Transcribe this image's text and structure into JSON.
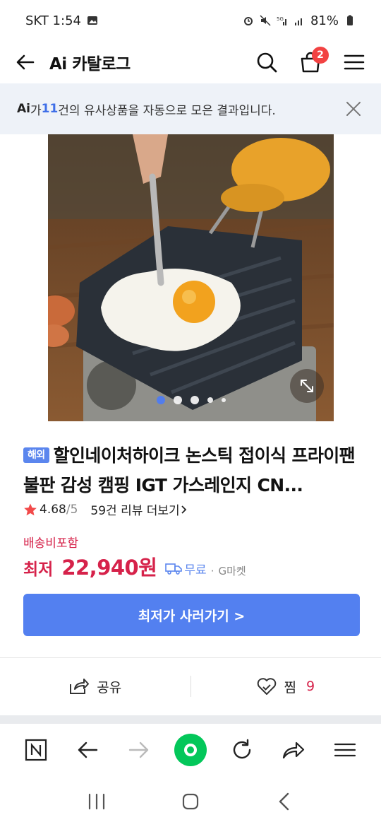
{
  "status_bar": {
    "carrier_time": "SKT 1:54",
    "battery": "81%"
  },
  "header": {
    "title": "Ai 카탈로그",
    "cart_count": "2"
  },
  "ai_banner": {
    "logo": "Ai",
    "prefix": "가 ",
    "count": "11",
    "suffix": "건의 유사상품을 자동으로 모은 결과입니다."
  },
  "product": {
    "badge": "해외",
    "title": "할인네이처하이크 논스틱 접이식 프라이팬 불판 감성 캠핑 IGT 가스레인지 CN...",
    "rating": "4.68",
    "rating_max": "/5",
    "reviews": "59건 리뷰 더보기",
    "shipping_note": "배송비포함",
    "price_label": "최저",
    "price": "22,940원",
    "free_shipping": "무료",
    "seller_sep": "·",
    "seller": "G마켓",
    "cta": "최저가 사러가기 >",
    "image_dots": 5,
    "active_dot": 1
  },
  "actions": {
    "share": "공유",
    "favorite": "찜",
    "favorite_count": "9"
  },
  "colors": {
    "accent": "#5380f0",
    "price": "#d6224a",
    "badge": "#f24242",
    "naver_green": "#03c75a"
  }
}
